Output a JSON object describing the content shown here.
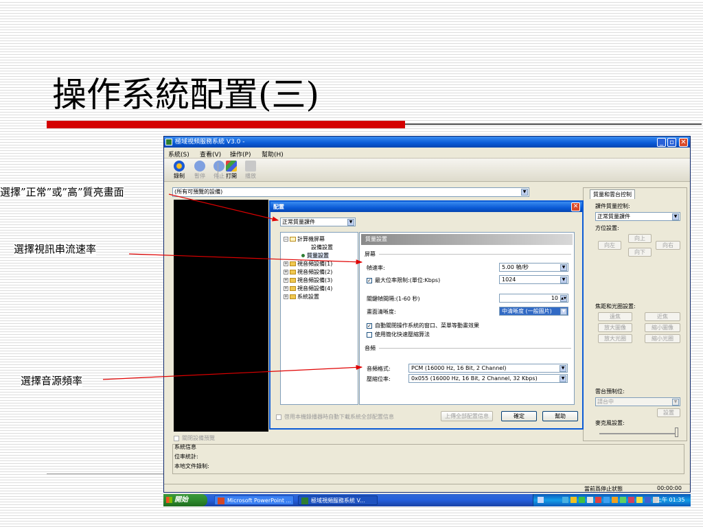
{
  "slide": {
    "title": "操作系統配置(三)"
  },
  "window": {
    "title": "極域視頻服務系統 V3.0 -",
    "menu": [
      "系統(S)",
      "查看(V)",
      "操作(P)",
      "幫助(H)"
    ],
    "toolbar": [
      {
        "label": "錄制",
        "icon": "record-icon",
        "enabled": true
      },
      {
        "label": "暫停",
        "icon": "pause-icon",
        "enabled": false
      },
      {
        "label": "停止",
        "icon": "stop-icon",
        "enabled": false
      },
      {
        "label": "打開",
        "icon": "open-icon",
        "enabled": true
      },
      {
        "label": "播放",
        "icon": "play-icon",
        "enabled": false
      }
    ],
    "device_combo": "(所有可預覽的設備)",
    "close_preview_label": "關閉設備預覽",
    "sysinfo": {
      "heading": "系統信息",
      "bitrate": "位率統計:",
      "local_file": "本地文件錄制:"
    },
    "status": {
      "state": "當前爲停止狀態",
      "time": "00:00:00"
    }
  },
  "right_panel": {
    "tab": "質量和雲台控制",
    "quality_label": "課件質量控制:",
    "quality_value": "正常質量課件",
    "direction_label": "方位設置:",
    "dir_up": "向上",
    "dir_left": "向左",
    "dir_right": "向右",
    "dir_down": "向下",
    "focus_label": "焦距和光圈設置:",
    "focus_far": "遠焦",
    "focus_near": "近焦",
    "zoom_in": "放大圖像",
    "zoom_out": "縮小圖像",
    "iris_open": "放大光圈",
    "iris_close": "縮小光圈",
    "preset_label": "雲台預制位:",
    "preset_value": "請台中",
    "preset_button": "設置",
    "mic_label": "麥克風設置:"
  },
  "dialog": {
    "title": "配置",
    "quality_combo": "正常質量課件",
    "tree": [
      {
        "label": "計算機屏幕",
        "type": "folder-open"
      },
      {
        "label": "設備設置",
        "type": "leaf"
      },
      {
        "label": "質量設置",
        "type": "leaf-selected"
      },
      {
        "label": "視音頻設備(1)",
        "type": "folder"
      },
      {
        "label": "視音頻設備(2)",
        "type": "folder"
      },
      {
        "label": "視音頻設備(3)",
        "type": "folder"
      },
      {
        "label": "視音頻設備(4)",
        "type": "folder"
      },
      {
        "label": "系統設置",
        "type": "folder"
      }
    ],
    "settings_title": "質量設置",
    "screen_section": "屏幕",
    "frame_rate_label": "幀速率:",
    "frame_rate_value": "5.00 幀/秒",
    "max_bitrate_label": "最大位率限制:(單位:Kbps)",
    "max_bitrate_value": "1024",
    "keyframe_label": "關鍵幀間隔:(1-60 秒)",
    "keyframe_value": "10",
    "clarity_label": "畫面清晰度:",
    "clarity_value": "中清晰度 (一般圖片)",
    "auto_close_label": "自動關閉操作系統的窗口、菜單等動畫效果",
    "fast_compress_label": "使用簡化快速壓縮算法",
    "audio_section": "音頻",
    "audio_format_label": "音頻格式:",
    "audio_format_value": "PCM (16000 Hz, 16 Bit, 2 Channel)",
    "compress_rate_label": "壓縮位率:",
    "compress_rate_value": "0x055 (16000 Hz, 16 Bit, 2 Channel,  32 Kbps)",
    "bottom_check": "啓用本機錄播器時自動下載系統全部配置信息",
    "upload_button": "上傳全部配置信息",
    "ok_button": "確定",
    "help_button": "幫助"
  },
  "taskbar": {
    "start": "開始",
    "tasks": [
      "Microsoft PowerPoint ...",
      "極域視頻服務系統 V..."
    ],
    "clock": "上午 01:35"
  },
  "annotations": {
    "quality": "選擇”正常”或”高”質亮畫面",
    "stream_rate": "選擇視訊串流速率",
    "audio_rate": "選擇音源頻率"
  },
  "colors": {
    "title_bar_red": "#d40000",
    "xp_blue": "#0a5ad6",
    "arrow_red": "#e00000"
  }
}
